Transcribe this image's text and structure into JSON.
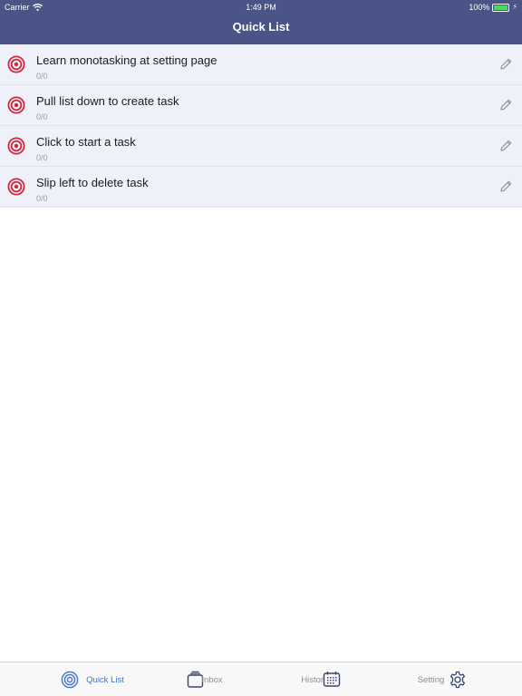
{
  "status_bar": {
    "carrier": "Carrier",
    "time": "1:49 PM",
    "battery": "100%",
    "wifi_icon": "wifi-icon",
    "battery_icon": "battery-icon"
  },
  "nav": {
    "title": "Quick List"
  },
  "tasks": [
    {
      "title": "Learn monotasking at setting page",
      "count": "0/0"
    },
    {
      "title": "Pull list down to create task",
      "count": "0/0"
    },
    {
      "title": "Click to start a task",
      "count": "0/0"
    },
    {
      "title": "Slip left to delete task",
      "count": "0/0"
    }
  ],
  "tab_bar": {
    "tabs": [
      {
        "label": "Quick List",
        "icon": "target-icon",
        "active": true
      },
      {
        "label": "Inbox",
        "icon": "inbox-icon",
        "active": false
      },
      {
        "label": "History",
        "icon": "calendar-icon",
        "active": false
      },
      {
        "label": "Setting",
        "icon": "gear-icon",
        "active": false
      }
    ]
  },
  "colors": {
    "header": "#4a5486",
    "row_background": "#eef1f9",
    "target_red": "#d0283c",
    "active_tab": "#3f74c9",
    "inactive_tab": "#8e8e93",
    "battery_green": "#4cd964"
  }
}
